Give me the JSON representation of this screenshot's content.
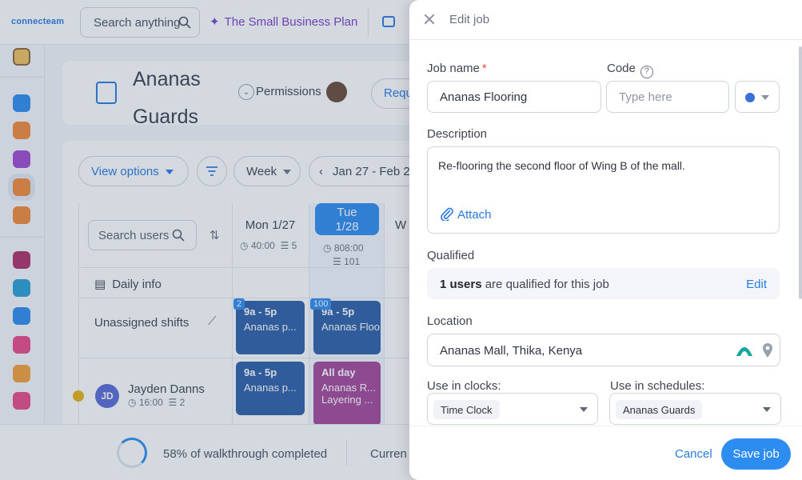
{
  "app": {
    "logo": "connecteam",
    "search_placeholder": "Search anything",
    "plan_label": "The Small Business Plan"
  },
  "page": {
    "title": "Ananas Guards",
    "permissions_label": "Permissions",
    "request_label": "Requ"
  },
  "schedule": {
    "view_options_label": "View options",
    "period_label": "Week",
    "date_range": "Jan 27 - Feb 2",
    "search_users_placeholder": "Search users",
    "days": [
      {
        "label": "Mon 1/27",
        "hours": "40:00",
        "shifts": "5"
      },
      {
        "label_line1": "Tue",
        "label_line2": "1/28",
        "hours": "808:00",
        "shifts": "101"
      },
      {
        "label": "W"
      }
    ],
    "rows": {
      "daily_info": "Daily info",
      "unassigned": "Unassigned shifts"
    },
    "unassigned_shifts": [
      {
        "badge": "2",
        "time": "9a - 5p",
        "name": "Ananas p..."
      },
      {
        "badge": "100",
        "time": "9a - 5p",
        "name": "Ananas Floo"
      }
    ],
    "user": {
      "initials": "JD",
      "name": "Jayden Danns",
      "hours": "16:00",
      "shifts": "2",
      "shift_mon": {
        "time": "9a - 5p",
        "name": "Ananas p..."
      },
      "shift_tue": {
        "time": "All day",
        "name": "Ananas R...",
        "extra": "Layering ..."
      }
    }
  },
  "walkthrough": {
    "progress_text": "58% of walkthrough completed",
    "progress_percent": 58,
    "current_label": "Curren"
  },
  "drawer": {
    "title": "Edit job",
    "job_name_label": "Job name",
    "required_mark": "*",
    "job_name_value": "Ananas Flooring",
    "code_label": "Code",
    "code_placeholder": "Type here",
    "color_value": "#3b6fd8",
    "description_label": "Description",
    "description_value": "Re-flooring the second floor of Wing B of the mall.",
    "attach_label": "Attach",
    "qualified_label": "Qualified",
    "qualified_count": "1 users",
    "qualified_suffix": "are qualified for this job",
    "qualified_edit": "Edit",
    "location_label": "Location",
    "location_value": "Ananas Mall, Thika, Kenya",
    "clocks_label": "Use in clocks:",
    "clocks_value": "Time Clock",
    "schedules_label": "Use in schedules:",
    "schedules_value": "Ananas Guards",
    "cancel_label": "Cancel",
    "save_label": "Save job"
  }
}
